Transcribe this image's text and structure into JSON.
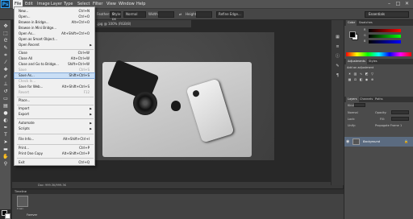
{
  "menubar": {
    "logo": "Ps",
    "items": [
      "File",
      "Edit",
      "Image",
      "Layer",
      "Type",
      "Select",
      "Filter",
      "View",
      "Window",
      "Help"
    ],
    "window_controls": [
      "–",
      "□",
      "✕"
    ]
  },
  "options_bar": {
    "feather_label": "Feather:",
    "feather_value": "0 px",
    "style_label": "Style:",
    "style_value": "Normal",
    "width_label": "Width:",
    "height_label": "Height:",
    "refine_edge": "Refine Edge...",
    "workspace": "Essentials"
  },
  "document": {
    "tab_title": ".jpg @ 100% (RGB/8)",
    "status": "Doc: 999.3K/999.3K"
  },
  "file_menu": {
    "items": [
      {
        "label": "New...",
        "shortcut": "Ctrl+N",
        "state": "normal"
      },
      {
        "label": "Open...",
        "shortcut": "Ctrl+O",
        "state": "normal"
      },
      {
        "label": "Browse in Bridge...",
        "shortcut": "Alt+Ctrl+O",
        "state": "normal"
      },
      {
        "label": "Browse in Mini Bridge...",
        "shortcut": "",
        "state": "normal"
      },
      {
        "label": "Open As...",
        "shortcut": "Alt+Shift+Ctrl+O",
        "state": "normal"
      },
      {
        "label": "Open as Smart Object...",
        "shortcut": "",
        "state": "normal"
      },
      {
        "label": "Open Recent",
        "shortcut": "",
        "state": "submenu"
      },
      {
        "label": "Close",
        "shortcut": "Ctrl+W",
        "state": "normal"
      },
      {
        "label": "Close All",
        "shortcut": "Alt+Ctrl+W",
        "state": "normal"
      },
      {
        "label": "Close and Go to Bridge...",
        "shortcut": "Shift+Ctrl+W",
        "state": "normal"
      },
      {
        "label": "Save",
        "shortcut": "Ctrl+S",
        "state": "disabled"
      },
      {
        "label": "Save As...",
        "shortcut": "Shift+Ctrl+S",
        "state": "highlight"
      },
      {
        "label": "Check In...",
        "shortcut": "",
        "state": "disabled"
      },
      {
        "label": "Save for Web...",
        "shortcut": "Alt+Shift+Ctrl+S",
        "state": "normal"
      },
      {
        "label": "Revert",
        "shortcut": "F12",
        "state": "disabled"
      },
      {
        "label": "Place...",
        "shortcut": "",
        "state": "normal"
      },
      {
        "label": "Import",
        "shortcut": "",
        "state": "submenu"
      },
      {
        "label": "Export",
        "shortcut": "",
        "state": "submenu"
      },
      {
        "label": "Automate",
        "shortcut": "",
        "state": "submenu"
      },
      {
        "label": "Scripts",
        "shortcut": "",
        "state": "submenu"
      },
      {
        "label": "File Info...",
        "shortcut": "Alt+Shift+Ctrl+I",
        "state": "normal"
      },
      {
        "label": "Print...",
        "shortcut": "Ctrl+P",
        "state": "normal"
      },
      {
        "label": "Print One Copy",
        "shortcut": "Alt+Shift+Ctrl+P",
        "state": "normal"
      },
      {
        "label": "Exit",
        "shortcut": "Ctrl+Q",
        "state": "normal"
      }
    ]
  },
  "timeline": {
    "title": "Timeline",
    "frame_label": "0 sec.",
    "loop": "Forever"
  },
  "panels": {
    "color_tabs": [
      "Color",
      "Swatches"
    ],
    "sliders": [
      "R",
      "G",
      "B"
    ],
    "adjustments_tabs": [
      "Adjustments",
      "Styles"
    ],
    "adjustments_title": "Add an adjustment",
    "layers_tabs": [
      "Layers",
      "Channels",
      "Paths"
    ],
    "kind_label": "Kind",
    "mode": "Normal",
    "opacity_label": "Opacity:",
    "lock_label": "Lock:",
    "fill_label": "Fill:",
    "unify_label": "Propagate Frame 1",
    "layer_name": "Background"
  },
  "colors": {
    "menu_active": "#f0f0f0",
    "highlight": "#c9def5",
    "layer_selected": "#5b6b80"
  }
}
